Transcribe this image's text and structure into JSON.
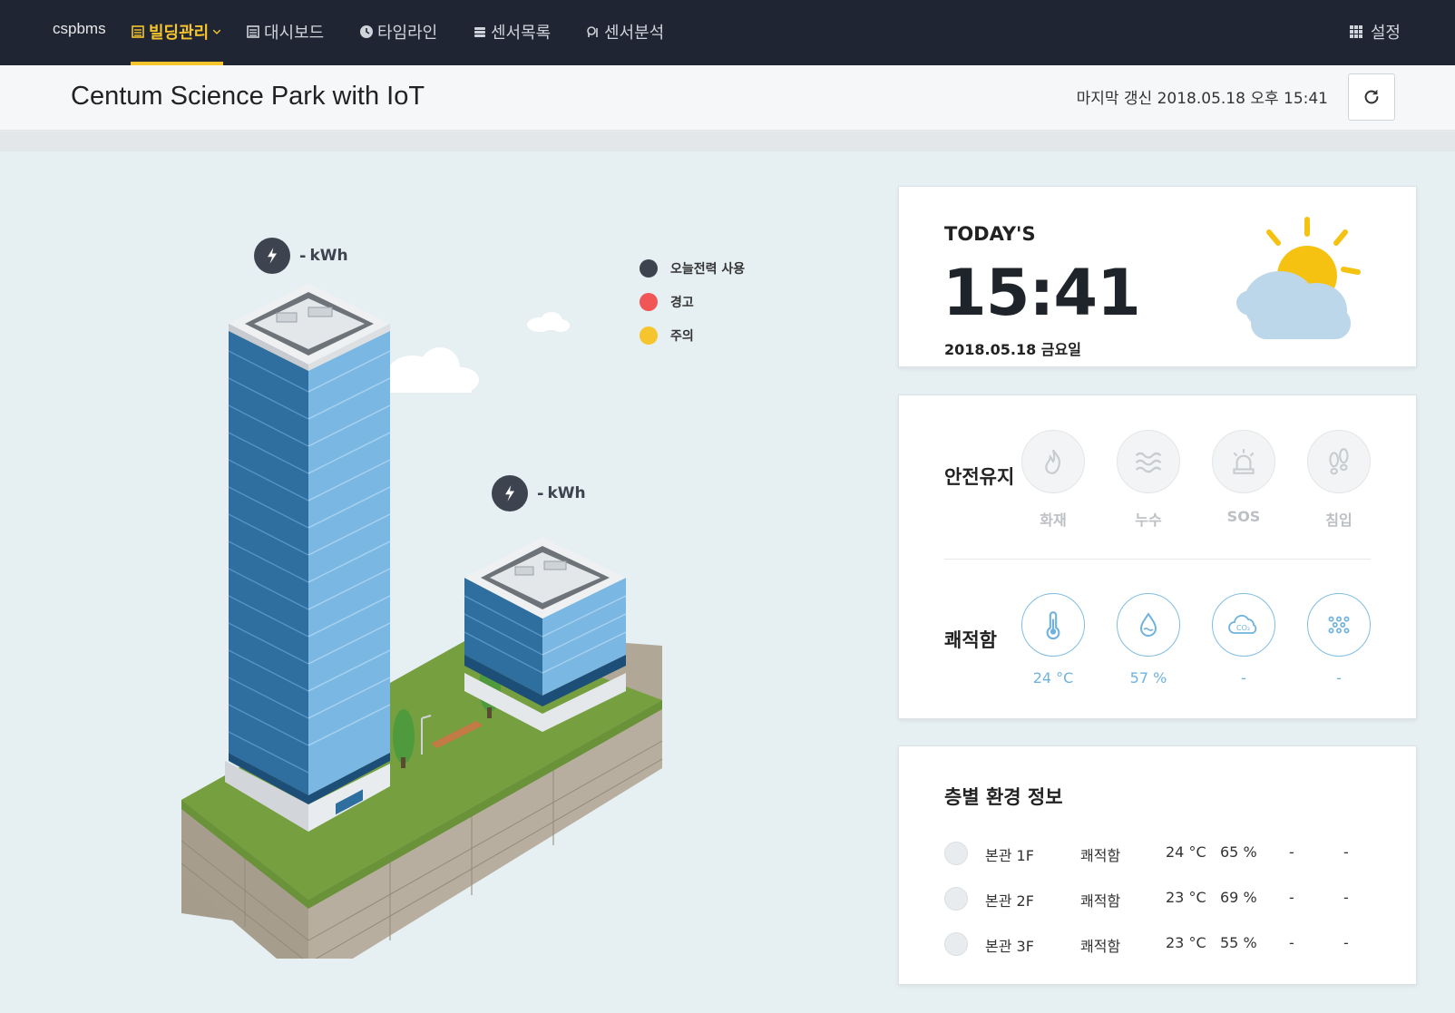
{
  "nav": {
    "brand": "cspbms",
    "items": [
      {
        "label": "빌딩관리",
        "icon": "building-icon",
        "active": true
      },
      {
        "label": "대시보드",
        "icon": "dashboard-icon"
      },
      {
        "label": "타임라인",
        "icon": "clock-icon"
      },
      {
        "label": "센서목록",
        "icon": "list-icon"
      },
      {
        "label": "센서분석",
        "icon": "analysis-icon"
      }
    ],
    "settings_label": "설정"
  },
  "header": {
    "title": "Centum Science Park with IoT",
    "last_update": "마지막 갱신 2018.05.18 오후 15:41"
  },
  "scene": {
    "tower_power": {
      "value": "-",
      "unit": "kWh"
    },
    "annex_power": {
      "value": "-",
      "unit": "kWh"
    },
    "legend": [
      {
        "label": "오늘전력 사용",
        "color": "#3d444f"
      },
      {
        "label": "경고",
        "color": "#f25555"
      },
      {
        "label": "주의",
        "color": "#f6c42c"
      }
    ]
  },
  "today": {
    "label": "TODAY'S",
    "time": "15:41",
    "date": "2018.05.18 금요일",
    "weather_icon": "partly-cloudy-icon"
  },
  "safety": {
    "label": "안전유지",
    "items": [
      {
        "label": "화재",
        "icon": "fire-icon"
      },
      {
        "label": "누수",
        "icon": "water-wave-icon"
      },
      {
        "label": "SOS",
        "icon": "siren-icon"
      },
      {
        "label": "침입",
        "icon": "footprint-icon"
      }
    ]
  },
  "comfort": {
    "label": "쾌적함",
    "items": [
      {
        "value": "24 °C",
        "icon": "thermometer-icon"
      },
      {
        "value": "57 %",
        "icon": "humidity-icon"
      },
      {
        "value": "-",
        "icon": "co2-icon"
      },
      {
        "value": "-",
        "icon": "dust-icon"
      }
    ]
  },
  "floors": {
    "title": "층별 환경 정보",
    "rows": [
      {
        "name": "본관 1F",
        "status": "쾌적함",
        "temp": "24 °C",
        "humidity": "65 %",
        "co2": "-",
        "dust": "-"
      },
      {
        "name": "본관 2F",
        "status": "쾌적함",
        "temp": "23 °C",
        "humidity": "69 %",
        "co2": "-",
        "dust": "-"
      },
      {
        "name": "본관 3F",
        "status": "쾌적함",
        "temp": "23 °C",
        "humidity": "55 %",
        "co2": "-",
        "dust": "-"
      }
    ]
  }
}
